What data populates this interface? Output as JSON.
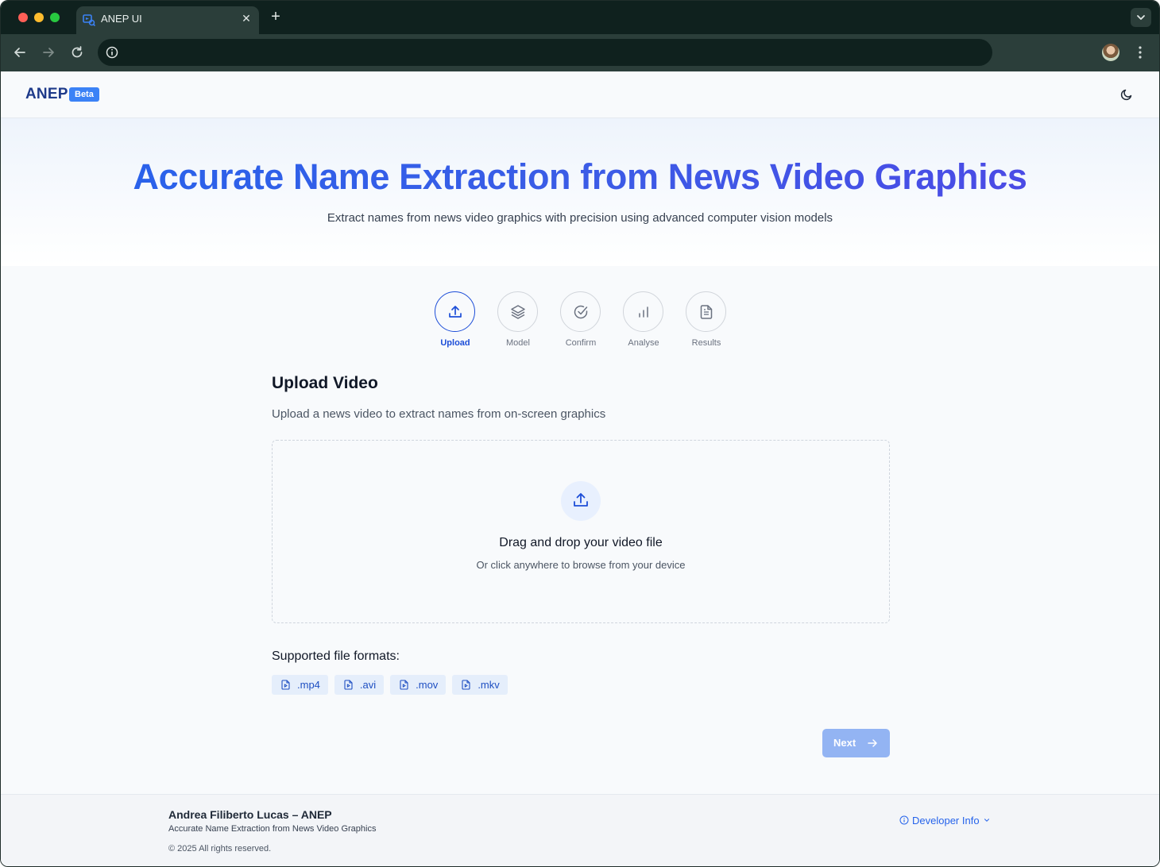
{
  "browser": {
    "tab_title": "ANEP UI",
    "url": ""
  },
  "header": {
    "brand": "ANEP",
    "badge": "Beta"
  },
  "hero": {
    "title": "Accurate Name Extraction from News Video Graphics",
    "subtitle": "Extract names from news video graphics with precision using advanced computer vision models"
  },
  "stepper": {
    "steps": [
      {
        "label": "Upload",
        "icon": "upload-icon",
        "active": true
      },
      {
        "label": "Model",
        "icon": "layers-icon",
        "active": false
      },
      {
        "label": "Confirm",
        "icon": "check-circle-icon",
        "active": false
      },
      {
        "label": "Analyse",
        "icon": "bar-chart-icon",
        "active": false
      },
      {
        "label": "Results",
        "icon": "document-icon",
        "active": false
      }
    ]
  },
  "upload": {
    "title": "Upload Video",
    "description": "Upload a news video to extract names from on-screen graphics",
    "dropzone_title": "Drag and drop your video file",
    "dropzone_subtitle": "Or click anywhere to browse from your device"
  },
  "formats": {
    "title": "Supported file formats:",
    "items": [
      ".mp4",
      ".avi",
      ".mov",
      ".mkv"
    ]
  },
  "actions": {
    "next_label": "Next"
  },
  "footer": {
    "name": "Andrea Filiberto Lucas – ANEP",
    "tagline": "Accurate Name Extraction from News Video Graphics",
    "copyright": "© 2025 All rights reserved.",
    "developer_info": "Developer Info"
  },
  "colors": {
    "accent": "#2563eb",
    "brand": "#1e3a8a",
    "badge": "#3b82f6",
    "next_disabled": "#93b4f3"
  }
}
